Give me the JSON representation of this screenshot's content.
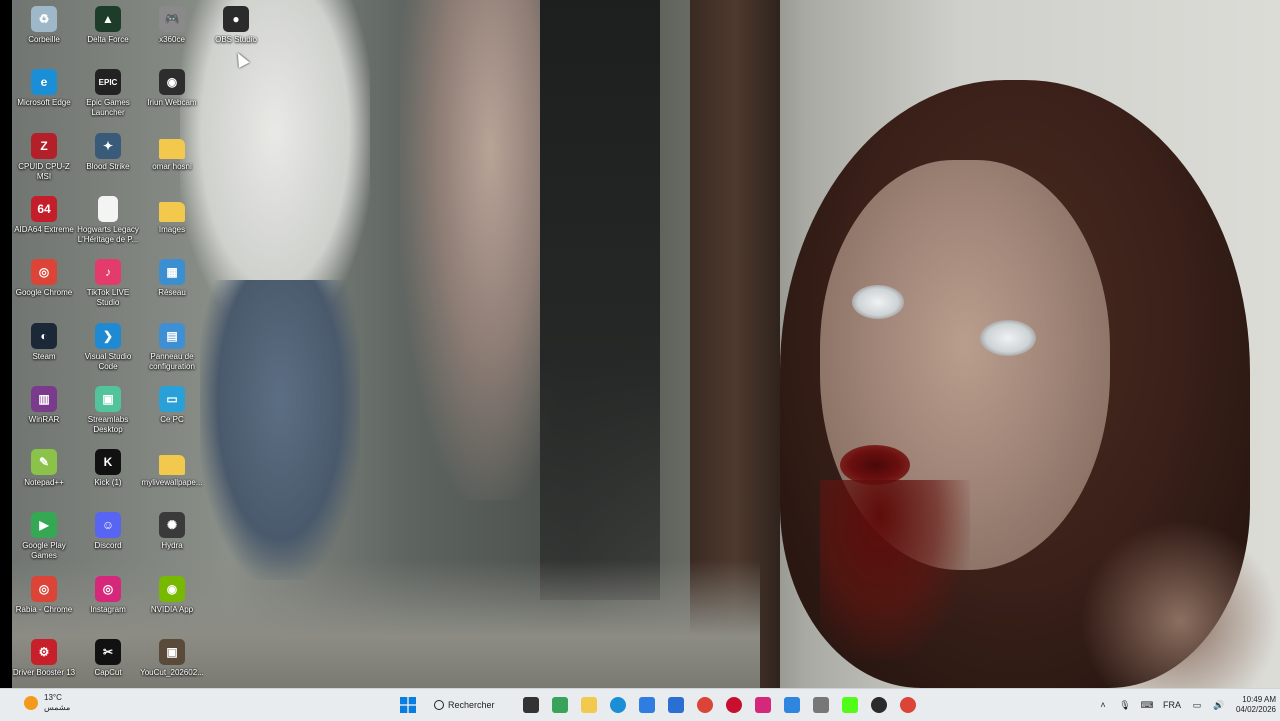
{
  "desktop": {
    "icons": [
      {
        "label": "Corbeille",
        "col": 0,
        "row": 0,
        "color": "#9fb8c9",
        "glyph": "♻",
        "icon": "recycle-bin-icon"
      },
      {
        "label": "Delta Force",
        "col": 1,
        "row": 0,
        "color": "#1d3d2a",
        "glyph": "▲",
        "icon": "delta-force-icon"
      },
      {
        "label": "x360ce",
        "col": 2,
        "row": 0,
        "color": "#8a8a8a",
        "glyph": "🎮",
        "icon": "gamepad-icon"
      },
      {
        "label": "OBS Studio",
        "col": 3,
        "row": 0,
        "color": "#2b2b2b",
        "glyph": "●",
        "icon": "obs-icon"
      },
      {
        "label": "Microsoft Edge",
        "col": 0,
        "row": 1,
        "color": "#1a8fd6",
        "glyph": "e",
        "icon": "edge-icon"
      },
      {
        "label": "Epic Games Launcher",
        "col": 1,
        "row": 1,
        "color": "#222222",
        "glyph": "EPIC",
        "icon": "epic-games-icon"
      },
      {
        "label": "Iriun Webcam",
        "col": 2,
        "row": 1,
        "color": "#2d2d2d",
        "glyph": "◉",
        "icon": "webcam-icon"
      },
      {
        "label": "CPUID CPU-Z MSI",
        "col": 0,
        "row": 2,
        "color": "#b3202a",
        "glyph": "Z",
        "icon": "cpuz-icon"
      },
      {
        "label": "Blood Strike",
        "col": 1,
        "row": 2,
        "color": "#3a5a7a",
        "glyph": "✦",
        "icon": "blood-strike-icon"
      },
      {
        "label": "omar hosni",
        "col": 2,
        "row": 2,
        "color": "#f2c94c",
        "glyph": "",
        "icon": "folder-icon"
      },
      {
        "label": "AIDA64 Extreme",
        "col": 0,
        "row": 3,
        "color": "#c41e2a",
        "glyph": "64",
        "icon": "aida64-icon"
      },
      {
        "label": "Hogwarts Legacy L'Héritage de P...",
        "col": 1,
        "row": 3,
        "color": "#f4f4f4",
        "glyph": "",
        "icon": "file-icon"
      },
      {
        "label": "Images",
        "col": 2,
        "row": 3,
        "color": "#f2c94c",
        "glyph": "",
        "icon": "folder-icon"
      },
      {
        "label": "Google Chrome",
        "col": 0,
        "row": 4,
        "color": "#db4437",
        "glyph": "◎",
        "icon": "chrome-icon"
      },
      {
        "label": "TikTok LIVE Studio",
        "col": 1,
        "row": 4,
        "color": "#e23b6c",
        "glyph": "♪",
        "icon": "tiktok-icon"
      },
      {
        "label": "Réseau",
        "col": 2,
        "row": 4,
        "color": "#3b8fd1",
        "glyph": "▦",
        "icon": "network-icon"
      },
      {
        "label": "Steam",
        "col": 0,
        "row": 5,
        "color": "#1b2838",
        "glyph": "◐",
        "icon": "steam-icon"
      },
      {
        "label": "Visual Studio Code",
        "col": 1,
        "row": 5,
        "color": "#1f8ad2",
        "glyph": "❯",
        "icon": "vscode-icon"
      },
      {
        "label": "Panneau de configuration",
        "col": 2,
        "row": 5,
        "color": "#3f8fd4",
        "glyph": "▤",
        "icon": "control-panel-icon"
      },
      {
        "label": "WinRAR",
        "col": 0,
        "row": 6,
        "color": "#7b3b8c",
        "glyph": "▥",
        "icon": "winrar-icon"
      },
      {
        "label": "Streamlabs Desktop",
        "col": 1,
        "row": 6,
        "color": "#53c39c",
        "glyph": "▣",
        "icon": "streamlabs-icon"
      },
      {
        "label": "Ce PC",
        "col": 2,
        "row": 6,
        "color": "#2aa0d8",
        "glyph": "▭",
        "icon": "pc-icon"
      },
      {
        "label": "Notepad++",
        "col": 0,
        "row": 7,
        "color": "#8bc34a",
        "glyph": "✎",
        "icon": "notepad-icon"
      },
      {
        "label": "Kick (1)",
        "col": 1,
        "row": 7,
        "color": "#111111",
        "glyph": "K",
        "icon": "kick-icon"
      },
      {
        "label": "mylivewallpape...",
        "col": 2,
        "row": 7,
        "color": "#f2c94c",
        "glyph": "",
        "icon": "folder-icon"
      },
      {
        "label": "Google Play Games",
        "col": 0,
        "row": 8,
        "color": "#34a853",
        "glyph": "▶",
        "icon": "play-games-icon"
      },
      {
        "label": "Discord",
        "col": 1,
        "row": 8,
        "color": "#5865f2",
        "glyph": "☺",
        "icon": "discord-icon"
      },
      {
        "label": "Hydra",
        "col": 2,
        "row": 8,
        "color": "#3a3a3a",
        "glyph": "✺",
        "icon": "hydra-icon"
      },
      {
        "label": "Rabia - Chrome",
        "col": 0,
        "row": 9,
        "color": "#db4437",
        "glyph": "◎",
        "icon": "chrome-profile-icon"
      },
      {
        "label": "Instagram",
        "col": 1,
        "row": 9,
        "color": "#d6287a",
        "glyph": "◎",
        "icon": "instagram-icon"
      },
      {
        "label": "NVIDIA App",
        "col": 2,
        "row": 9,
        "color": "#76b900",
        "glyph": "◉",
        "icon": "nvidia-icon"
      },
      {
        "label": "Driver Booster 13",
        "col": 0,
        "row": 10,
        "color": "#c8202a",
        "glyph": "⚙",
        "icon": "driver-booster-icon"
      },
      {
        "label": "CapCut",
        "col": 1,
        "row": 10,
        "color": "#111111",
        "glyph": "✂",
        "icon": "capcut-icon"
      },
      {
        "label": "YouCut_202602...",
        "col": 2,
        "row": 10,
        "color": "#5a4a3a",
        "glyph": "▣",
        "icon": "video-file-icon"
      }
    ]
  },
  "taskbar": {
    "weather": {
      "temp": "13°C",
      "desc": "مشمس"
    },
    "search_label": "Rechercher",
    "apps": [
      {
        "icon": "task-view-icon",
        "color": "#333333"
      },
      {
        "icon": "widgets-icon",
        "color": "#3aa35a"
      },
      {
        "icon": "file-explorer-icon",
        "color": "#f2c94c"
      },
      {
        "icon": "edge-icon",
        "color": "#1a8fd6"
      },
      {
        "icon": "copilot-icon",
        "color": "#2f7de1"
      },
      {
        "icon": "store-icon",
        "color": "#2a6fd1"
      },
      {
        "icon": "chrome-icon",
        "color": "#db4437"
      },
      {
        "icon": "opera-gx-icon",
        "color": "#c8102e"
      },
      {
        "icon": "instagram-icon",
        "color": "#d6287a"
      },
      {
        "icon": "photos-icon",
        "color": "#2e86de"
      },
      {
        "icon": "app-icon",
        "color": "#777777"
      },
      {
        "icon": "kick-icon",
        "color": "#53fc18"
      },
      {
        "icon": "obs-icon",
        "color": "#2b2b2b"
      },
      {
        "icon": "chrome-profile-icon",
        "color": "#db4437"
      }
    ],
    "tray": {
      "lang": "FRA",
      "time": "10:49 AM",
      "date": "04/02/2026"
    }
  }
}
